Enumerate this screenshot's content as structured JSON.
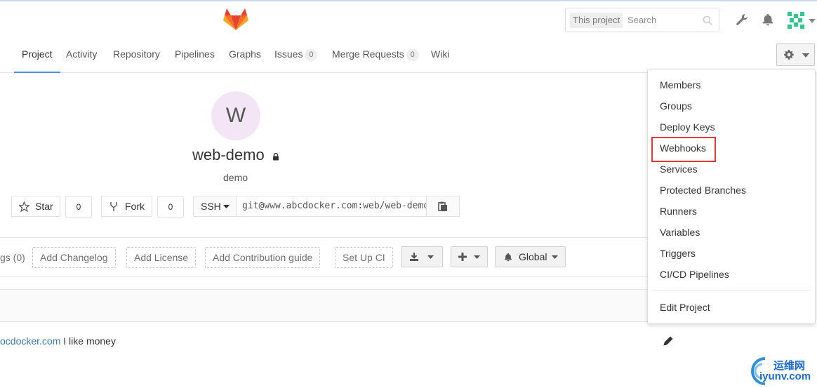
{
  "header": {
    "search": {
      "scope": "This project",
      "placeholder": "Search"
    }
  },
  "nav": {
    "items": [
      {
        "label": "Project",
        "active": true
      },
      {
        "label": "Activity"
      },
      {
        "label": "Repository"
      },
      {
        "label": "Pipelines"
      },
      {
        "label": "Graphs"
      },
      {
        "label": "Issues",
        "count": "0"
      },
      {
        "label": "Merge Requests",
        "count": "0"
      },
      {
        "label": "Wiki"
      }
    ]
  },
  "project": {
    "avatar_letter": "W",
    "name": "web-demo",
    "description": "demo",
    "star": {
      "label": "Star",
      "count": "0"
    },
    "fork": {
      "label": "Fork",
      "count": "0"
    },
    "clone": {
      "protocol": "SSH",
      "url": "git@www.abcdocker.com:web/web-demo.git"
    }
  },
  "actions": {
    "tags": "gs (0)",
    "add_changelog": "Add Changelog",
    "add_license": "Add License",
    "add_contribution": "Add Contribution guide",
    "setup_ci": "Set Up CI",
    "notification": "Global"
  },
  "commit": {
    "author_link": "ocdocker.com",
    "message": " I like money"
  },
  "settings_menu": {
    "items": [
      "Members",
      "Groups",
      "Deploy Keys",
      "Webhooks",
      "Services",
      "Protected Branches",
      "Runners",
      "Variables",
      "Triggers",
      "CI/CD Pipelines"
    ],
    "edit": "Edit Project",
    "highlighted": "Webhooks",
    "highlight_color": "#e53935"
  },
  "watermark": {
    "line1": "运维网",
    "line2": "iyunv.com"
  },
  "colors": {
    "accent": "#4a90e2",
    "link": "#3777b0",
    "logo": "#e2432a"
  }
}
